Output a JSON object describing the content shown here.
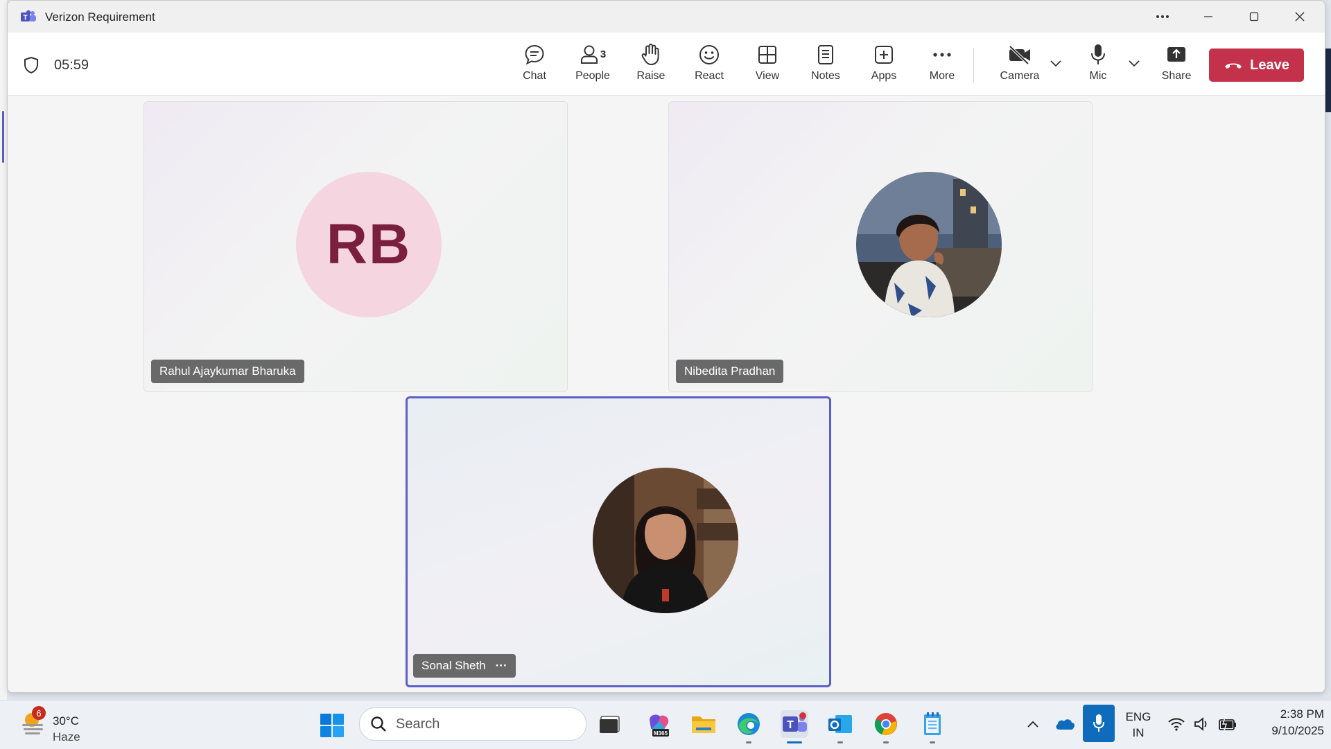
{
  "window": {
    "title": "Verizon Requirement"
  },
  "meeting": {
    "timer": "05:59",
    "people_count": "3"
  },
  "toolbar": {
    "chat": "Chat",
    "people": "People",
    "raise": "Raise",
    "react": "React",
    "view": "View",
    "notes": "Notes",
    "apps": "Apps",
    "more": "More",
    "camera": "Camera",
    "mic": "Mic",
    "share": "Share",
    "leave": "Leave"
  },
  "participants": [
    {
      "name": "Rahul Ajaykumar Bharuka",
      "initials": "RB"
    },
    {
      "name": "Nibedita Pradhan"
    },
    {
      "name": "Sonal Sheth",
      "more": "···"
    }
  ],
  "taskbar": {
    "weather_temp": "30°C",
    "weather_desc": "Haze",
    "weather_badge": "6",
    "search_placeholder": "Search",
    "m365_label": "M365",
    "lang_top": "ENG",
    "lang_bottom": "IN",
    "time": "2:38 PM",
    "date": "9/10/2025"
  },
  "colors": {
    "accent": "#5b5fc7",
    "leave": "#c4314b",
    "rb_avatar_bg": "#f5d5e0",
    "rb_avatar_text": "#7a1f3d"
  }
}
